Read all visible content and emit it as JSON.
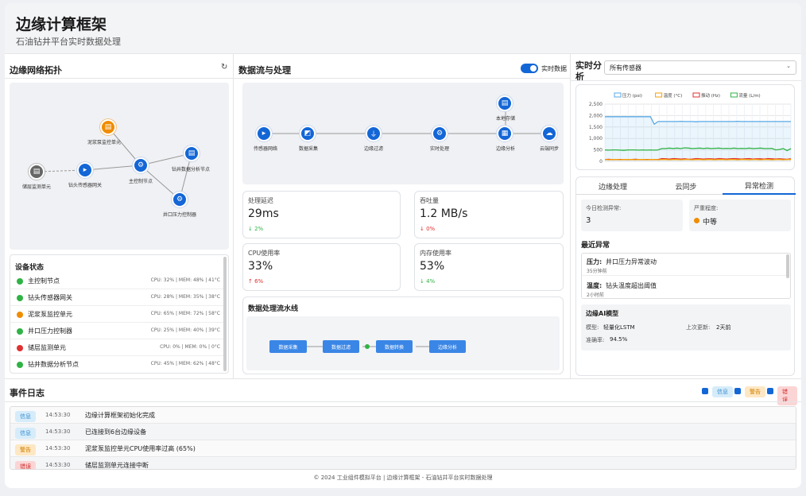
{
  "header": {
    "title": "边缘计算框架",
    "subtitle": "石油钻井平台实时数据处理"
  },
  "topology": {
    "title": "边缘网络拓扑",
    "refresh_icon": "refresh-icon",
    "nodes": [
      {
        "label": "泥浆泵监控单元",
        "color": "#f08c00"
      },
      {
        "label": "钻井数据分析节点",
        "color": "#1366d6"
      },
      {
        "label": "主控制节点",
        "color": "#1366d6"
      },
      {
        "label": "储层监测单元",
        "color": "#666666"
      },
      {
        "label": "钻头传感器网关",
        "color": "#1366d6"
      },
      {
        "label": "井口压力控制器",
        "color": "#1366d6"
      }
    ]
  },
  "devices": {
    "title": "设备状态",
    "items": [
      {
        "name": "主控制节点",
        "status_color": "#2fb344",
        "metrics": "CPU: 32% | MEM: 48% | 41°C"
      },
      {
        "name": "钻头传感器网关",
        "status_color": "#2fb344",
        "metrics": "CPU: 28% | MEM: 35% | 38°C"
      },
      {
        "name": "泥浆泵监控单元",
        "status_color": "#f08c00",
        "metrics": "CPU: 65% | MEM: 72% | 58°C"
      },
      {
        "name": "井口压力控制器",
        "status_color": "#2fb344",
        "metrics": "CPU: 25% | MEM: 40% | 39°C"
      },
      {
        "name": "储层监测单元",
        "status_color": "#e03131",
        "metrics": "CPU: 0% | MEM: 0% | 0°C"
      },
      {
        "name": "钻井数据分析节点",
        "status_color": "#2fb344",
        "metrics": "CPU: 45% | MEM: 62% | 48°C"
      }
    ]
  },
  "dataflow": {
    "title": "数据流与处理",
    "realtime_label": "实时数据",
    "nodes": [
      "传感器网络",
      "数据采集",
      "边缘过滤",
      "实时处理",
      "边缘分析",
      "云端同步",
      "本地存储"
    ],
    "metrics": [
      {
        "label": "处理延迟",
        "value": "29ms",
        "change": "↓ 2%",
        "change_color": "#2fb344"
      },
      {
        "label": "吞吐量",
        "value": "1.2 MB/s",
        "change": "↓ 0%",
        "change_color": "#e03131"
      },
      {
        "label": "CPU使用率",
        "value": "33%",
        "change": "↑ 6%",
        "change_color": "#e03131"
      },
      {
        "label": "内存使用率",
        "value": "53%",
        "change": "↓ 4%",
        "change_color": "#2fb344"
      }
    ],
    "pipeline_title": "数据处理流水线",
    "pipeline": [
      "数据采集",
      "数据过滤",
      "数据转换",
      "边缘分析"
    ]
  },
  "realtime": {
    "title_line1": "实时分",
    "title_line2": "析",
    "select_value": "所有传感器",
    "legend": [
      {
        "name": "压力 (psi)",
        "color": "#5aa9e6"
      },
      {
        "name": "温度 (°C)",
        "color": "#f59f00"
      },
      {
        "name": "振动 (Hz)",
        "color": "#e03131"
      },
      {
        "name": "流量 (L/m)",
        "color": "#2fb344"
      }
    ]
  },
  "chart_data": {
    "type": "line",
    "y_ticks": [
      "2,500",
      "2,000",
      "1,500",
      "1,000",
      "500",
      "0"
    ],
    "ylim": [
      0,
      2500
    ],
    "grid": true,
    "legend_position": "top",
    "series": [
      {
        "name": "压力 (psi)",
        "color": "#5aa9e6",
        "values": [
          1950,
          1950,
          1950,
          1950,
          1950,
          1950,
          1950,
          1950,
          1950,
          1950,
          1950,
          1950,
          1950,
          1620,
          1740,
          1740,
          1740,
          1740,
          1740,
          1740,
          1750,
          1740,
          1740,
          1740,
          1730,
          1740,
          1740,
          1740,
          1740,
          1740,
          1740,
          1740,
          1740,
          1740,
          1740,
          1750,
          1740,
          1740,
          1740,
          1740,
          1740,
          1740,
          1740,
          1740,
          1740,
          1740,
          1740,
          1740,
          1740,
          1740
        ]
      },
      {
        "name": "流量 (L/m)",
        "color": "#2fb344",
        "values": [
          500,
          490,
          500,
          500,
          490,
          480,
          500,
          500,
          500,
          490,
          500,
          490,
          500,
          490,
          500,
          560,
          560,
          580,
          560,
          580,
          560,
          590,
          580,
          560,
          570,
          580,
          560,
          580,
          560,
          570,
          580,
          560,
          570,
          560,
          580,
          560,
          570,
          560,
          580,
          560,
          570,
          580,
          560,
          560,
          570,
          500,
          520,
          560,
          470,
          560
        ]
      },
      {
        "name": "振动 (Hz)",
        "color": "#e03131",
        "values": [
          80,
          90,
          75,
          80,
          85,
          80,
          75,
          80,
          90,
          80,
          75,
          80,
          85,
          80,
          75,
          120,
          110,
          100,
          120,
          110,
          100,
          110,
          90,
          100,
          120,
          110,
          100,
          110,
          110,
          100,
          120,
          110,
          100,
          110,
          120,
          110,
          100,
          110,
          120,
          100,
          110,
          110,
          100,
          120,
          110,
          100,
          110,
          100,
          90,
          110
        ]
      },
      {
        "name": "温度 (°C)",
        "color": "#f59f00",
        "values": [
          80,
          70,
          80,
          80,
          70,
          80,
          80,
          80,
          70,
          80,
          80,
          70,
          80,
          80,
          70,
          80,
          80,
          70,
          80,
          80,
          70,
          80,
          80,
          70,
          80,
          80,
          70,
          80,
          80,
          70,
          80,
          80,
          70,
          80,
          80,
          70,
          80,
          80,
          70,
          80,
          80,
          70,
          80,
          80,
          70,
          80,
          80,
          70,
          80,
          80
        ]
      }
    ]
  },
  "analysis": {
    "tabs": [
      "边缘处理",
      "云同步",
      "异常检测"
    ],
    "active_tab": 2,
    "today_label": "今日检测异常:",
    "today_value": "3",
    "severity_label": "严重程度:",
    "severity_value": "中等",
    "severity_color": "#f08c00",
    "recent_title": "最近异常",
    "anomalies": [
      {
        "type": "压力:",
        "desc": "井口压力异常波动",
        "time": "35分钟前"
      },
      {
        "type": "温度:",
        "desc": "钻头温度超出阈值",
        "time": "2小时前"
      }
    ],
    "ai_title": "边缘AI模型",
    "model_label": "模型:",
    "model_value": "轻量化LSTM",
    "update_label": "上次更新:",
    "update_value": "2天前",
    "acc_label": "准确率:",
    "acc_value": "94.5%"
  },
  "events": {
    "title": "事件日志",
    "filters": [
      {
        "label": "信息",
        "bg": "#d6ecfa",
        "fg": "#3b8ed0"
      },
      {
        "label": "警告",
        "bg": "#fde7c4",
        "fg": "#d08000"
      },
      {
        "label": "错误",
        "bg": "#fbd5d5",
        "fg": "#d03030"
      }
    ],
    "rows": [
      {
        "level": "信息",
        "bg": "#d6ecfa",
        "fg": "#3b8ed0",
        "time": "14:53:30",
        "msg": "边缘计算框架初始化完成"
      },
      {
        "level": "信息",
        "bg": "#d6ecfa",
        "fg": "#3b8ed0",
        "time": "14:53:30",
        "msg": "已连接到6台边缘设备"
      },
      {
        "level": "警告",
        "bg": "#fde7c4",
        "fg": "#d08000",
        "time": "14:53:30",
        "msg": "泥浆泵监控单元CPU使用率过高 (65%)"
      },
      {
        "level": "错误",
        "bg": "#fbd5d5",
        "fg": "#d03030",
        "time": "14:53:30",
        "msg": "储层监测单元连接中断"
      }
    ]
  },
  "footer": "© 2024 工业组件模拟平台 | 边缘计算框架 - 石油钻井平台实时数据处理"
}
